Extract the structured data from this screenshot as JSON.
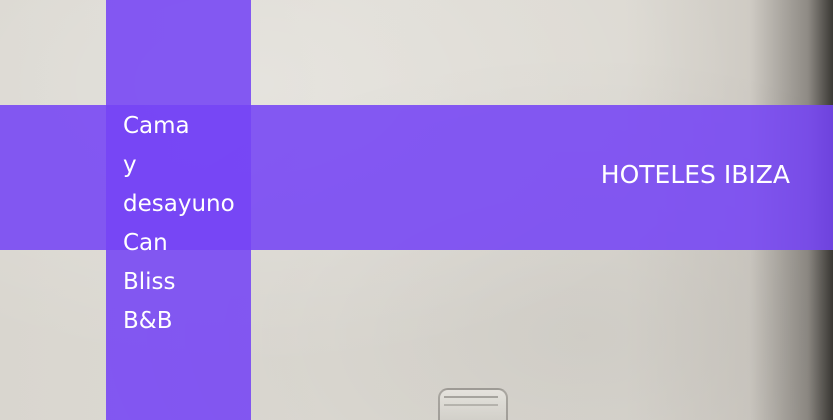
{
  "hotel_name": "Cama y desayuno Can Bliss B&B",
  "category_label": "HOTELES IBIZA",
  "colors": {
    "band": "#7544f5",
    "text": "#ffffff",
    "wall": "#dcd9d2"
  }
}
